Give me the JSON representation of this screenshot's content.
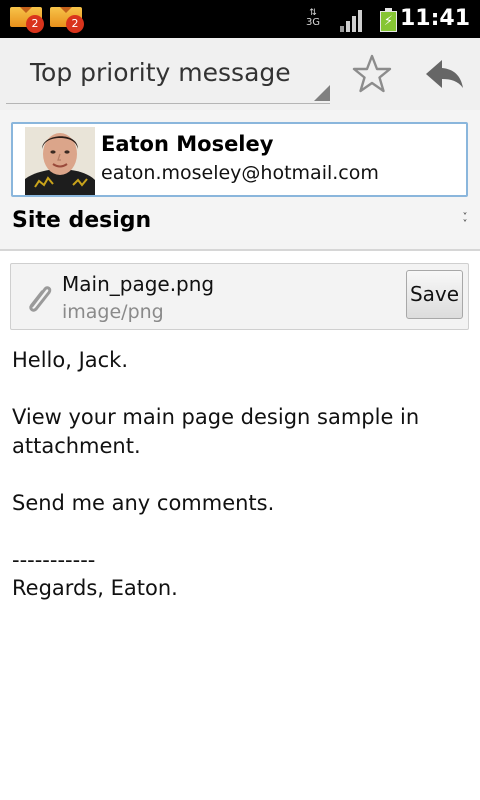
{
  "status_bar": {
    "notifications": [
      {
        "icon": "gmail-envelope-icon",
        "badge": "2"
      },
      {
        "icon": "gmail-envelope-icon",
        "badge": "2"
      }
    ],
    "network_label": "3G",
    "time": "11:41",
    "colors": {
      "badge": "#d9341c",
      "battery": "#86c534"
    }
  },
  "header": {
    "priority_label": "Top priority message",
    "star_icon": "star-outline-icon",
    "reply_icon": "reply-icon"
  },
  "sender": {
    "name": "Eaton Moseley",
    "email": "eaton.moseley@hotmail.com",
    "avatar": "sender-photo"
  },
  "subject": "Site design",
  "attachment": {
    "icon": "paperclip-icon",
    "filename": "Main_page.png",
    "mime_type": "image/png",
    "save_label": "Save"
  },
  "body": {
    "greeting": "Hello, Jack.",
    "line1": "View your main page design sample in attachment.",
    "line2": "Send me any comments.",
    "separator": "-----------",
    "signature": "Regards, Eaton."
  }
}
